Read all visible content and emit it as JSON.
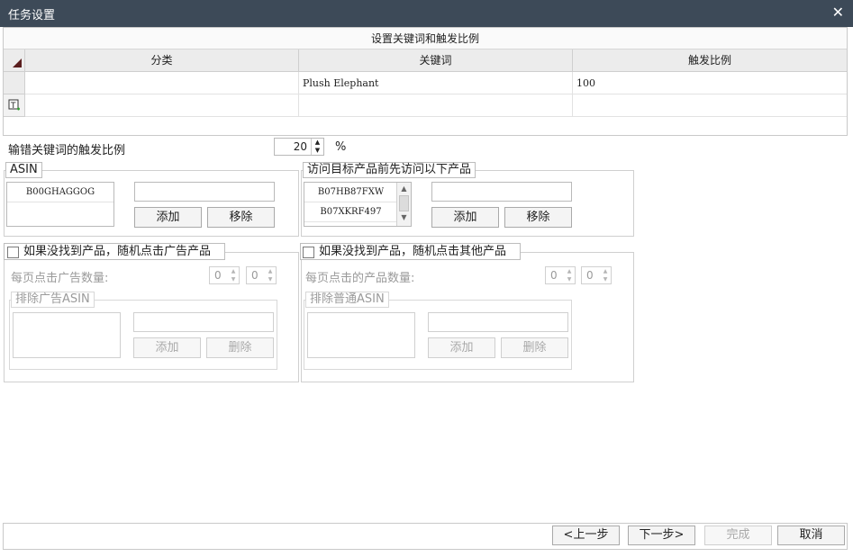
{
  "window": {
    "title": "任务设置",
    "close": "✕"
  },
  "keyword_grid": {
    "title": "设置关键词和触发比例",
    "columns": [
      "分类",
      "关键词",
      "触发比例"
    ],
    "rows": [
      {
        "category": "",
        "keyword": "Plush Elephant",
        "ratio": "100"
      }
    ]
  },
  "typo_ratio": {
    "label": "输错关键词的触发比例",
    "value": "20",
    "unit": "%"
  },
  "asin_group": {
    "legend": "ASIN",
    "items": [
      "B00GHAGGOG"
    ],
    "input_value": "",
    "add_label": "添加",
    "remove_label": "移除"
  },
  "pre_visit_group": {
    "legend": "访问目标产品前先访问以下产品",
    "items": [
      "B07HB87FXW",
      "B07XKRF497"
    ],
    "input_value": "",
    "add_label": "添加",
    "remove_label": "移除"
  },
  "ad_group": {
    "checkbox_label": "如果没找到产品，随机点击广告产品",
    "checked": false,
    "per_page_label": "每页点击广告数量:",
    "spin1": "0",
    "spin2": "0",
    "exclude_legend": "排除广告ASIN",
    "add_label": "添加",
    "delete_label": "删除"
  },
  "other_group": {
    "checkbox_label": "如果没找到产品，随机点击其他产品",
    "checked": false,
    "per_page_label": "每页点击的产品数量:",
    "spin1": "0",
    "spin2": "0",
    "exclude_legend": "排除普通ASIN",
    "add_label": "添加",
    "delete_label": "删除"
  },
  "footer": {
    "prev_label": "<上一步",
    "next_label": "下一步>",
    "finish_label": "完成",
    "cancel_label": "取消"
  },
  "colors": {
    "titlebar": "#3d4a58",
    "header_bg": "#ececec",
    "disabled_text": "#9a9a9a"
  }
}
